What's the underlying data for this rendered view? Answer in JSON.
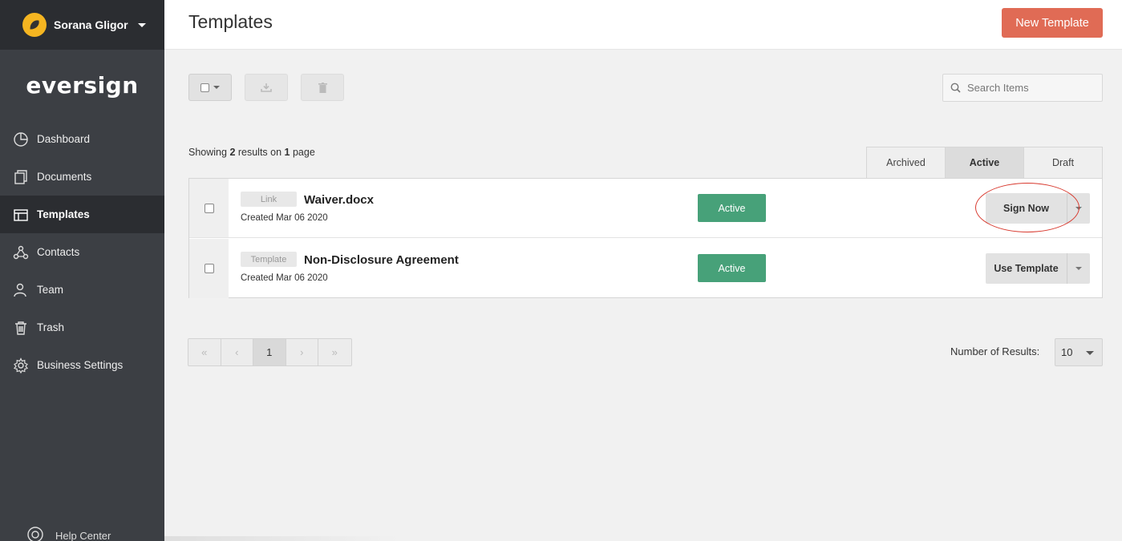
{
  "user": {
    "name": "Sorana Gligor"
  },
  "brand": {
    "logo": "eversign",
    "accent": "#e06b55",
    "active_green": "#47a179"
  },
  "sidebar": {
    "items": [
      {
        "label": "Dashboard",
        "icon": "pie-chart-icon"
      },
      {
        "label": "Documents",
        "icon": "documents-icon"
      },
      {
        "label": "Templates",
        "icon": "templates-icon",
        "active": true
      },
      {
        "label": "Contacts",
        "icon": "contacts-icon"
      },
      {
        "label": "Team",
        "icon": "team-icon"
      },
      {
        "label": "Trash",
        "icon": "trash-icon"
      },
      {
        "label": "Business Settings",
        "icon": "gear-icon"
      }
    ],
    "help": "Help Center"
  },
  "header": {
    "title": "Templates",
    "new_button": "New Template"
  },
  "search": {
    "placeholder": "Search Items"
  },
  "summary": {
    "prefix": "Showing ",
    "count": "2",
    "middle": " results on ",
    "pages": "1",
    "suffix": " page"
  },
  "tabs": [
    {
      "label": "Archived"
    },
    {
      "label": "Active",
      "active": true
    },
    {
      "label": "Draft"
    }
  ],
  "rows": [
    {
      "type": "Link",
      "name": "Waiver.docx",
      "created": "Created Mar 06 2020",
      "status": "Active",
      "action": "Sign Now"
    },
    {
      "type": "Template",
      "name": "Non-Disclosure Agreement",
      "created": "Created Mar 06 2020",
      "status": "Active",
      "action": "Use Template"
    }
  ],
  "pagination": {
    "first": "«",
    "prev": "‹",
    "current": "1",
    "next": "›",
    "last": "»"
  },
  "results": {
    "label": "Number of Results:",
    "value": "10"
  }
}
